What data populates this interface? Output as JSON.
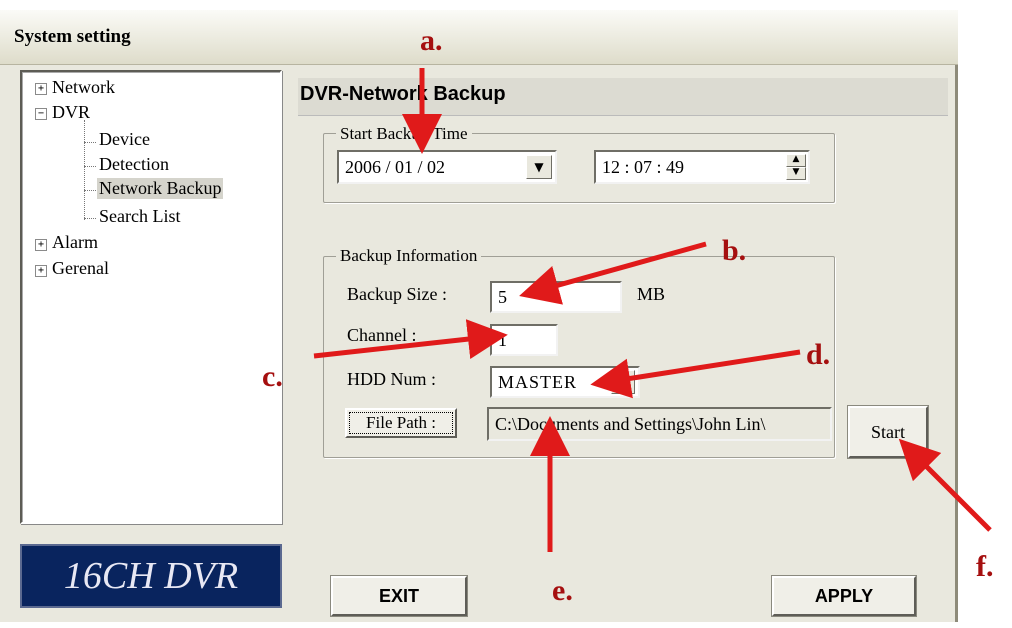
{
  "window": {
    "title": "System setting"
  },
  "tree": {
    "items": [
      {
        "label": "Network",
        "expander": "+"
      },
      {
        "label": "DVR",
        "expander": "−"
      },
      {
        "label": "Device"
      },
      {
        "label": "Detection"
      },
      {
        "label": "Network Backup"
      },
      {
        "label": "Search List"
      },
      {
        "label": "Alarm",
        "expander": "+"
      },
      {
        "label": "Gerenal",
        "expander": "+"
      }
    ]
  },
  "logo": {
    "text": "16CH DVR"
  },
  "panel": {
    "title": "DVR-Network Backup"
  },
  "start_backup": {
    "legend": "Start Backup Time",
    "date_value": "2006 / 01 / 02",
    "time_value": "12 : 07 : 49"
  },
  "backup_info": {
    "legend": "Backup Information",
    "size_label": "Backup Size :",
    "size_value": "5",
    "size_unit": "MB",
    "channel_label": "Channel :",
    "channel_value": "1",
    "hdd_label": "HDD Num :",
    "hdd_value": "MASTER",
    "file_path_button": "File Path :",
    "file_path_value": "C:\\Documents and Settings\\John Lin\\"
  },
  "buttons": {
    "start": "Start",
    "exit": "EXIT",
    "apply": "APPLY"
  },
  "annotations": {
    "a": "a.",
    "b": "b.",
    "c": "c.",
    "d": "d.",
    "e": "e.",
    "f": "f."
  },
  "colors": {
    "annotation": "#a50f0f",
    "window_bg": "#e9e8de",
    "logo_bg": "#09245e"
  }
}
